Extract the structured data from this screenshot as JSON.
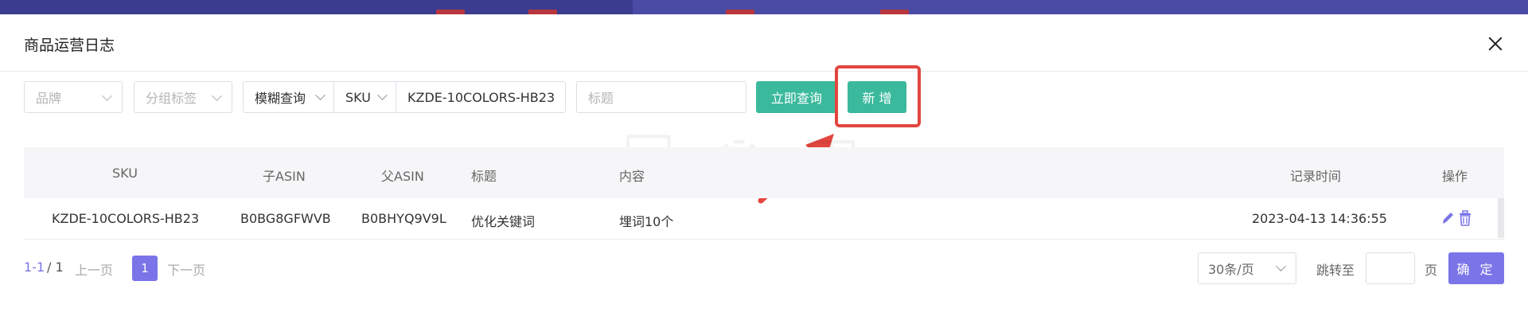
{
  "dialog": {
    "title": "商品运营日志"
  },
  "filters": {
    "brand_placeholder": "品牌",
    "group_tag_placeholder": "分组标签",
    "search_mode": "模糊查询",
    "field_type": "SKU",
    "sku_value": "KZDE-10COLORS-HB23",
    "title_placeholder": "标题",
    "query_button": "立即查询",
    "add_button": "新 增"
  },
  "table": {
    "columns": [
      "SKU",
      "子ASIN",
      "父ASIN",
      "标题",
      "内容",
      "记录时间",
      "操作"
    ],
    "rows": [
      [
        "KZDE-10COLORS-HB23",
        "B0BG8GFWVB",
        "B0BHYQ9V9L",
        "优化关键词",
        "埋词10个",
        "2023-04-13 14:36:55"
      ]
    ]
  },
  "pagination": {
    "range": "1-1",
    "total": "/ 1",
    "prev": "上一页",
    "current": "1",
    "next": "下一页",
    "page_size": "30条/页",
    "jump_label": "跳转至",
    "page_unit": "页",
    "confirm": "确 定"
  },
  "colors": {
    "accent_green": "#3bb99c",
    "accent_purple": "#7b74e8",
    "highlight_red": "#e2463f"
  }
}
